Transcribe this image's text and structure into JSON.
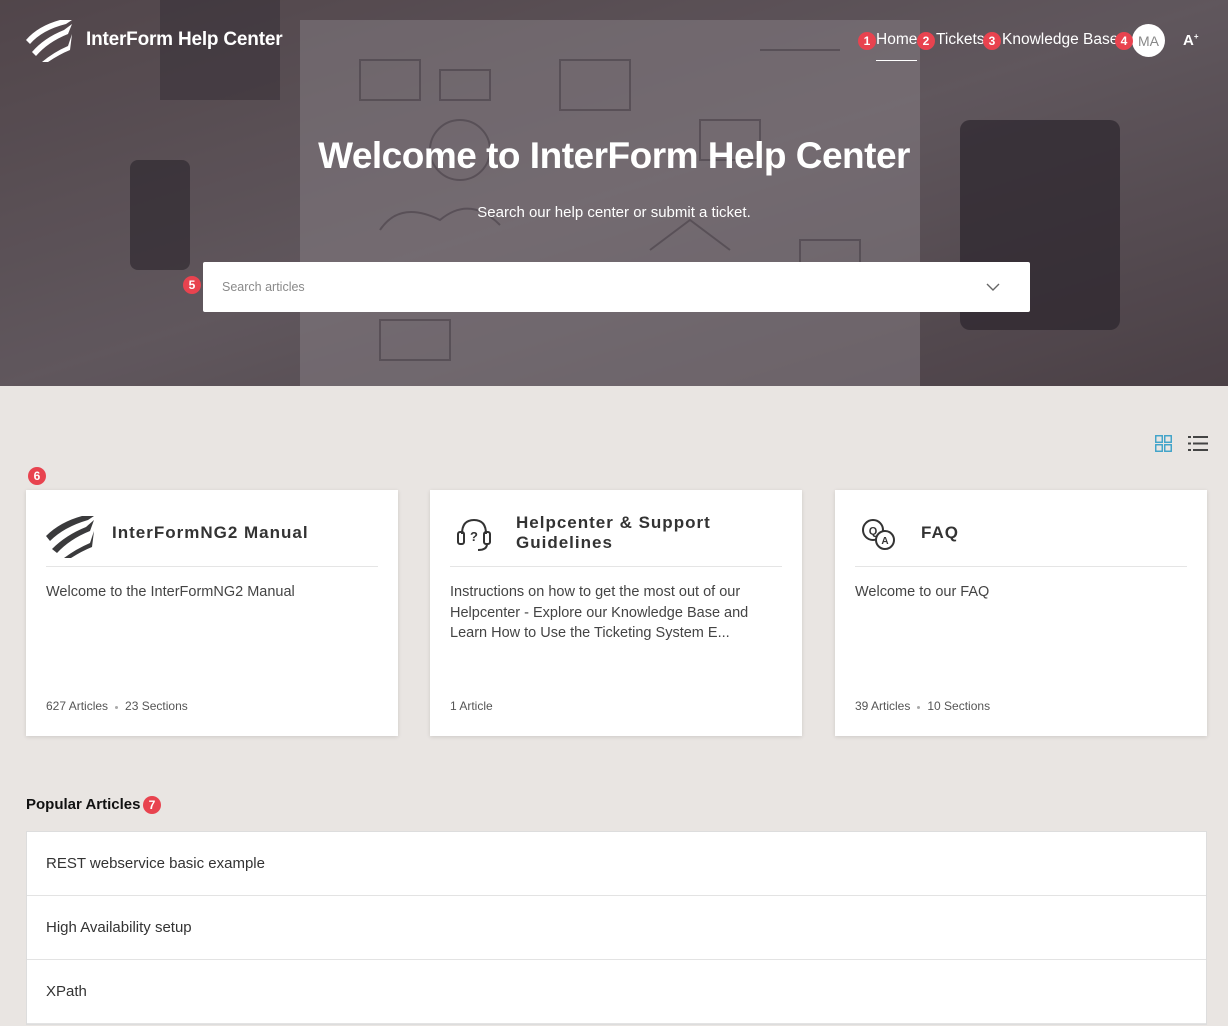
{
  "header": {
    "brand": "InterForm Help Center",
    "nav": [
      {
        "label": "Home",
        "badge": "1"
      },
      {
        "label": "Tickets",
        "badge": "2"
      },
      {
        "label": "Knowledge Base",
        "badge": "3"
      }
    ],
    "avatar": {
      "initials": "MA",
      "badge": "4"
    },
    "font_toggle": "A"
  },
  "hero": {
    "title": "Welcome to InterForm Help Center",
    "subtitle": "Search our help center or submit a ticket.",
    "search": {
      "placeholder": "Search articles",
      "value": "",
      "badge": "5"
    }
  },
  "categories": {
    "badge": "6",
    "items": [
      {
        "icon": "interform-logo-icon",
        "title": "InterFormNG2 Manual",
        "description": "Welcome to the InterFormNG2 Manual",
        "articles": "627 Articles",
        "sections": "23 Sections"
      },
      {
        "icon": "support-headset-icon",
        "title": "Helpcenter & Support Guidelines",
        "description": "Instructions on how to get the most out of our Helpcenter - Explore our Knowledge Base and Learn How to Use the Ticketing System E...",
        "articles": "1 Article",
        "sections": ""
      },
      {
        "icon": "faq-bubbles-icon",
        "title": "FAQ",
        "description": "Welcome to our FAQ",
        "articles": "39 Articles",
        "sections": "10 Sections"
      }
    ]
  },
  "popular": {
    "title": "Popular Articles",
    "badge": "7",
    "items": [
      "REST webservice basic example",
      "High Availability setup",
      "XPath"
    ]
  },
  "colors": {
    "badge": "#e8434f",
    "accent": "#3aa0c8",
    "page_bg": "#e9e5e2"
  }
}
